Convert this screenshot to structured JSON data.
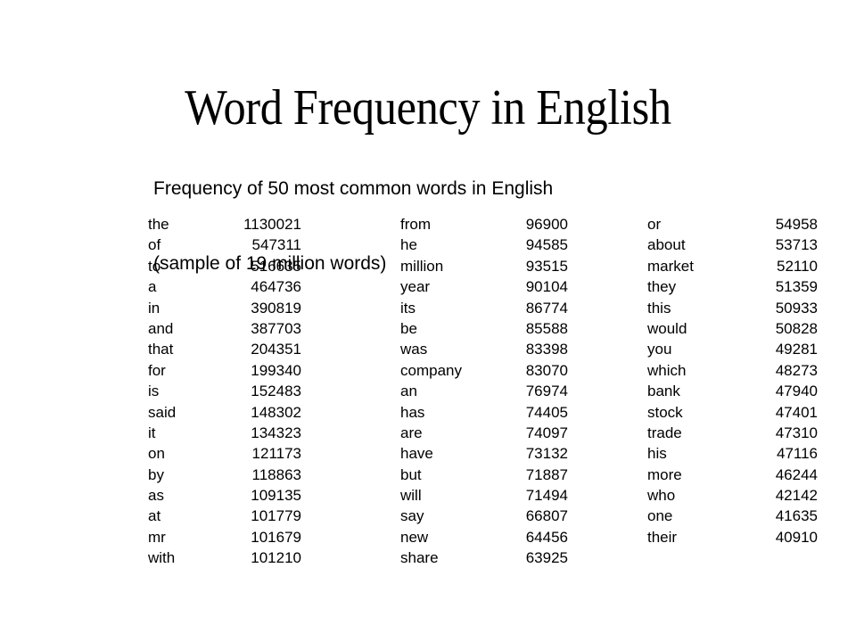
{
  "slide": {
    "title": "Word Frequency in English",
    "subtitle_lines": [
      "Frequency of 50 most common words in English",
      "(sample of 19 million words)"
    ],
    "background_color": "#ffffff",
    "text_color": "#000000"
  },
  "chart_data": {
    "type": "table",
    "title": "Word Frequency in English",
    "subtitle": "Frequency of 50 most common words in English (sample of 19 million words)",
    "xlabel": "",
    "ylabel": "Frequency",
    "sample_size_words": 19000000,
    "word_count": 50,
    "columns": [
      {
        "index": 1,
        "rows": [
          {
            "word": "the",
            "count": "1130021"
          },
          {
            "word": "of",
            "count": "547311"
          },
          {
            "word": "to",
            "count": "516635"
          },
          {
            "word": "a",
            "count": "464736"
          },
          {
            "word": "in",
            "count": "390819"
          },
          {
            "word": "and",
            "count": "387703"
          },
          {
            "word": "that",
            "count": "204351"
          },
          {
            "word": "for",
            "count": "199340"
          },
          {
            "word": "is",
            "count": "152483"
          },
          {
            "word": "said",
            "count": "148302"
          },
          {
            "word": "it",
            "count": "134323"
          },
          {
            "word": "on",
            "count": "121173"
          },
          {
            "word": "by",
            "count": "118863"
          },
          {
            "word": "as",
            "count": "109135"
          },
          {
            "word": "at",
            "count": "101779"
          },
          {
            "word": "mr",
            "count": "101679"
          },
          {
            "word": "with",
            "count": "101210"
          }
        ]
      },
      {
        "index": 2,
        "rows": [
          {
            "word": "from",
            "count": "96900"
          },
          {
            "word": "he",
            "count": "94585"
          },
          {
            "word": "million",
            "count": "93515"
          },
          {
            "word": "year",
            "count": "90104"
          },
          {
            "word": "its",
            "count": "86774"
          },
          {
            "word": "be",
            "count": "85588"
          },
          {
            "word": "was",
            "count": "83398"
          },
          {
            "word": "company",
            "count": "83070"
          },
          {
            "word": "an",
            "count": "76974"
          },
          {
            "word": "has",
            "count": "74405"
          },
          {
            "word": "are",
            "count": "74097"
          },
          {
            "word": "have",
            "count": "73132"
          },
          {
            "word": "but",
            "count": "71887"
          },
          {
            "word": "will",
            "count": "71494"
          },
          {
            "word": "say",
            "count": "66807"
          },
          {
            "word": "new",
            "count": "64456"
          },
          {
            "word": "share",
            "count": "63925"
          }
        ]
      },
      {
        "index": 3,
        "rows": [
          {
            "word": "or",
            "count": "54958"
          },
          {
            "word": "about",
            "count": "53713"
          },
          {
            "word": "market",
            "count": "52110"
          },
          {
            "word": "they",
            "count": "51359"
          },
          {
            "word": "this",
            "count": "50933"
          },
          {
            "word": "would",
            "count": "50828"
          },
          {
            "word": "you",
            "count": "49281"
          },
          {
            "word": "which",
            "count": "48273"
          },
          {
            "word": "bank",
            "count": "47940"
          },
          {
            "word": "stock",
            "count": "47401"
          },
          {
            "word": "trade",
            "count": "47310"
          },
          {
            "word": "his",
            "count": "47116"
          },
          {
            "word": "more",
            "count": "46244"
          },
          {
            "word": "who",
            "count": "42142"
          },
          {
            "word": "one",
            "count": "41635"
          },
          {
            "word": "their",
            "count": "40910"
          }
        ]
      }
    ]
  }
}
